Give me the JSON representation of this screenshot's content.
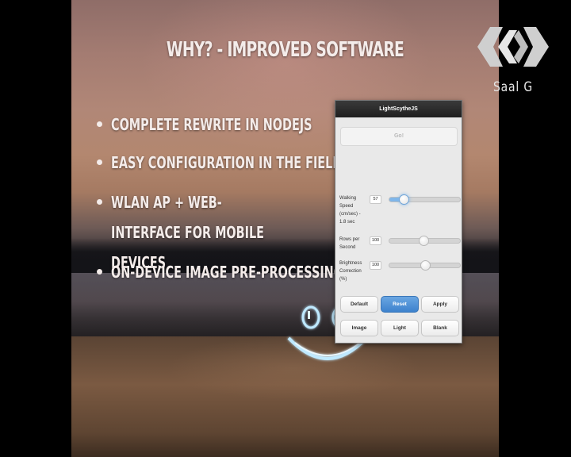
{
  "slide": {
    "title": "WHY? - IMPROVED SOFTWARE",
    "bullets": [
      "COMPLETE REWRITE IN NODEJS",
      "EASY CONFIGURATION IN THE FIELD",
      "WLAN AP + WEB-INTERFACE FOR MOBILE DEVICES",
      "ON-DEVICE IMAGE PRE-PROCESSING"
    ]
  },
  "phone": {
    "app_title": "LightScytheJS",
    "go_label": "Go!",
    "settings": [
      {
        "label": "Walking Speed (cm/sec) - 1.8 sec",
        "value": "57",
        "fraction": 0.2,
        "accent": "#7fb6ea"
      },
      {
        "label": "Rows per Second",
        "value": "100",
        "fraction": 0.48,
        "accent": "#d4d4d4"
      },
      {
        "label": "Brightness Correction (%)",
        "value": "100",
        "fraction": 0.5,
        "accent": "#d4d4d4"
      }
    ],
    "buttons_row1": [
      "Default",
      "Reset",
      "Apply"
    ],
    "buttons_row2": [
      "Image",
      "Light",
      "Blank"
    ]
  },
  "logo": {
    "text": "Saal G"
  },
  "colors": {
    "text": "#f4ecea",
    "primary_button": "#4a8fd6",
    "phone_header": "#2a2a2a"
  }
}
